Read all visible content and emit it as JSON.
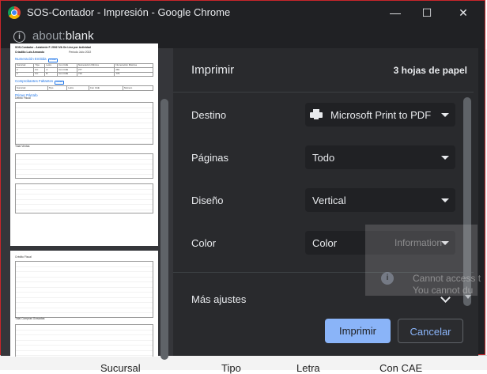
{
  "window": {
    "title": "SOS-Contador - Impresión - Google Chrome",
    "url_scheme": "about:",
    "url_path": "blank",
    "controls": {
      "minimize": "—",
      "maximize": "☐",
      "close": "✕"
    }
  },
  "print": {
    "title": "Imprimir",
    "sheets": "3 hojas de papel",
    "destination_label": "Destino",
    "destination_value": "Microsoft Print to PDF",
    "pages_label": "Páginas",
    "pages_value": "Todo",
    "layout_label": "Diseño",
    "layout_value": "Vertical",
    "color_label": "Color",
    "color_value": "Color",
    "more_settings": "Más ajustes",
    "print_button": "Imprimir",
    "cancel_button": "Cancelar"
  },
  "background": {
    "columns": [
      "Sucursal",
      "Tipo",
      "Letra",
      "Con CAE"
    ],
    "info_title": "Information",
    "info_line1": "Cannot access t",
    "info_line2": "You cannot du"
  },
  "preview": {
    "header_small": "SOS-Contador - Asistente F. 2002 IVA On Line por Actividad",
    "company": "Criadillo Luis Armando",
    "period_label": "Periodo",
    "period_value": "Julio 2022",
    "sec1": "Numeración Emitida",
    "sec2": "Comprobantes Faltantes",
    "sec3": "Primer Párrafo",
    "sec4": "Débito Fiscal",
    "pill": "Ocultar",
    "table1_head": [
      "Sucursal",
      "Tipo",
      "Letra",
      "Con CAE",
      "Numeración Mínima",
      "Numeración Máxima"
    ],
    "table1_rows": [
      [
        "2",
        "FC",
        "A",
        "Con CAE",
        "277",
        "281"
      ],
      [
        "2",
        "FC",
        "B",
        "Con CAE",
        "710",
        "775"
      ]
    ],
    "table2_head": [
      "Sucursal",
      "Tipo",
      "Letra",
      "Con CAE",
      "Número"
    ],
    "total_label": "Total Ventas",
    "page2_sec": "Crédito Fiscal",
    "page2_total": "Total Compras Gravadas"
  }
}
